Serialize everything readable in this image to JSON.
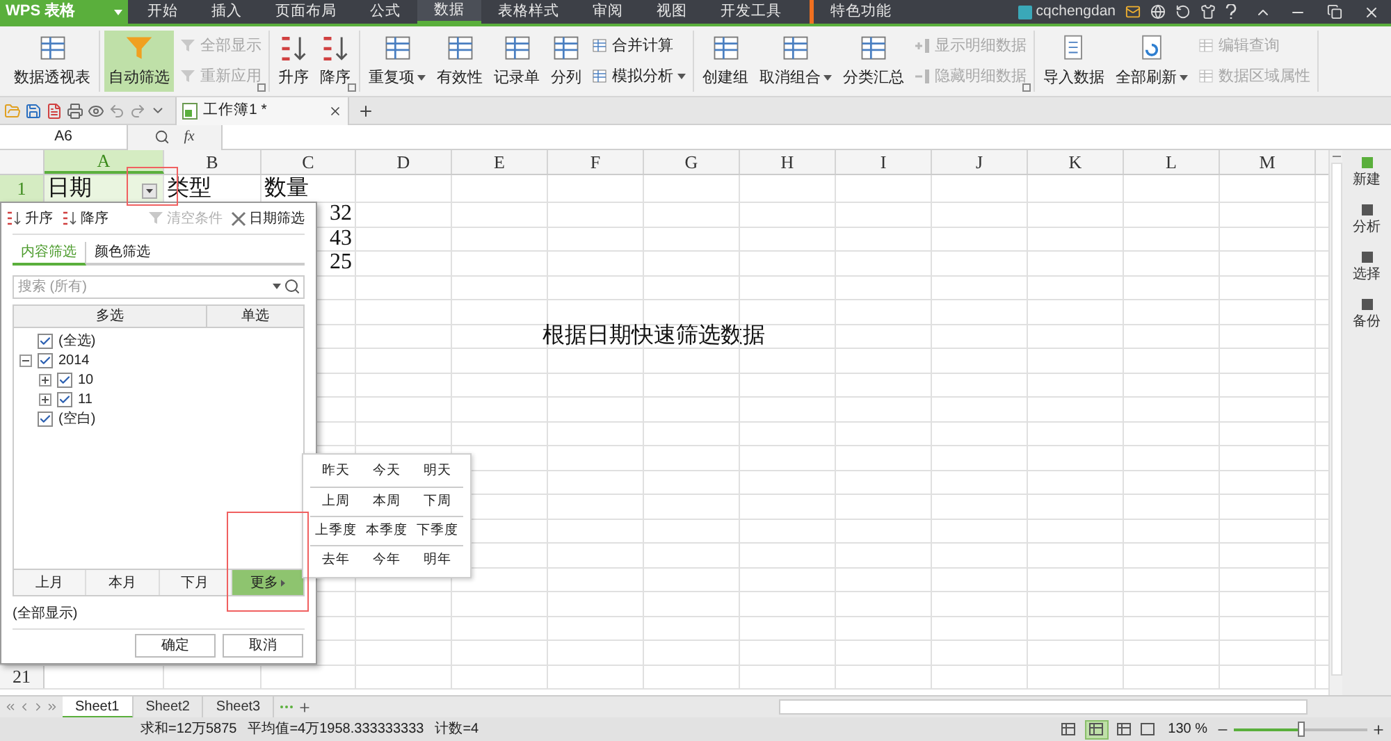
{
  "app_menu": {
    "label": "WPS 表格"
  },
  "menu_tabs": [
    {
      "label": "开始",
      "selected": false
    },
    {
      "label": "插入",
      "selected": false
    },
    {
      "label": "页面布局",
      "selected": false
    },
    {
      "label": "公式",
      "selected": false
    },
    {
      "label": "数据",
      "selected": true
    },
    {
      "label": "表格样式",
      "selected": false
    },
    {
      "label": "审阅",
      "selected": false
    },
    {
      "label": "视图",
      "selected": false
    },
    {
      "label": "开发工具",
      "selected": false
    },
    {
      "label": "特色功能",
      "selected": false
    }
  ],
  "user": {
    "name": "cqchengdan"
  },
  "ribbon": [
    {
      "launcher": false,
      "items": [
        {
          "label": "数据透视表",
          "kind": "large",
          "disabled": false,
          "on": false,
          "dropdown": false
        }
      ]
    },
    {
      "launcher": true,
      "items": [
        {
          "label": "自动筛选",
          "kind": "large",
          "disabled": false,
          "on": true,
          "dropdown": false
        },
        {
          "label": "全部显示",
          "kind": "small",
          "disabled": true,
          "on": false,
          "dropdown": false
        },
        {
          "label": "重新应用",
          "kind": "small",
          "disabled": true,
          "on": false,
          "dropdown": false
        }
      ]
    },
    {
      "launcher": true,
      "items": [
        {
          "label": "升序",
          "kind": "large",
          "disabled": false,
          "on": false,
          "dropdown": false
        },
        {
          "label": "降序",
          "kind": "large",
          "disabled": false,
          "on": false,
          "dropdown": false
        }
      ]
    },
    {
      "launcher": false,
      "items": [
        {
          "label": "重复项",
          "kind": "large",
          "disabled": false,
          "on": false,
          "dropdown": true
        },
        {
          "label": "有效性",
          "kind": "large",
          "disabled": false,
          "on": false,
          "dropdown": false
        },
        {
          "label": "记录单",
          "kind": "large",
          "disabled": false,
          "on": false,
          "dropdown": false
        },
        {
          "label": "分列",
          "kind": "large",
          "disabled": false,
          "on": false,
          "dropdown": false
        },
        {
          "label": "合并计算",
          "kind": "small",
          "disabled": false,
          "on": false,
          "dropdown": false
        },
        {
          "label": "模拟分析",
          "kind": "small",
          "disabled": false,
          "on": false,
          "dropdown": true
        }
      ]
    },
    {
      "launcher": true,
      "items": [
        {
          "label": "创建组",
          "kind": "large",
          "disabled": false,
          "on": false,
          "dropdown": false
        },
        {
          "label": "取消组合",
          "kind": "large",
          "disabled": false,
          "on": false,
          "dropdown": true
        },
        {
          "label": "分类汇总",
          "kind": "large",
          "disabled": false,
          "on": false,
          "dropdown": false
        },
        {
          "label": "显示明细数据",
          "kind": "small",
          "disabled": true,
          "on": false,
          "dropdown": false
        },
        {
          "label": "隐藏明细数据",
          "kind": "small",
          "disabled": true,
          "on": false,
          "dropdown": false
        }
      ]
    },
    {
      "launcher": false,
      "items": [
        {
          "label": "导入数据",
          "kind": "large",
          "disabled": false,
          "on": false,
          "dropdown": false
        },
        {
          "label": "全部刷新",
          "kind": "large",
          "disabled": false,
          "on": false,
          "dropdown": true
        },
        {
          "label": "编辑查询",
          "kind": "small",
          "disabled": true,
          "on": false,
          "dropdown": false
        },
        {
          "label": "数据区域属性",
          "kind": "small",
          "disabled": true,
          "on": false,
          "dropdown": false
        }
      ]
    }
  ],
  "document_tab": {
    "title": "工作簿1 *"
  },
  "name_box": {
    "value": "A6"
  },
  "formula_label": "fx",
  "columns": [
    {
      "label": "A",
      "selected": true
    },
    {
      "label": "B",
      "selected": false
    },
    {
      "label": "C",
      "selected": false
    },
    {
      "label": "D",
      "selected": false
    },
    {
      "label": "E",
      "selected": false
    },
    {
      "label": "F",
      "selected": false
    },
    {
      "label": "G",
      "selected": false
    },
    {
      "label": "H",
      "selected": false
    },
    {
      "label": "I",
      "selected": false
    },
    {
      "label": "J",
      "selected": false
    },
    {
      "label": "K",
      "selected": false
    },
    {
      "label": "L",
      "selected": false
    },
    {
      "label": "M",
      "selected": false
    }
  ],
  "rows": [
    {
      "number": "1",
      "selected": true,
      "filter_button": true,
      "cells": {
        "A": "日期",
        "B": "类型",
        "C": "数量"
      }
    },
    {
      "cells": {
        "C": "32"
      }
    },
    {
      "cells": {
        "C": "43"
      }
    },
    {
      "cells": {
        "C": "25"
      }
    },
    {},
    {},
    {
      "cells": {
        "F": "根据日期快速筛选数据"
      }
    },
    {},
    {},
    {},
    {},
    {},
    {},
    {},
    {},
    {},
    {},
    {},
    {},
    {},
    {
      "number": "21",
      "selected": false
    }
  ],
  "filter_panel": {
    "sort_buttons": [
      "升序",
      "降序"
    ],
    "clear": {
      "label": "清空条件",
      "disabled": true
    },
    "date_filter": "日期筛选",
    "tabs": [
      {
        "label": "内容筛选",
        "selected": true
      },
      {
        "label": "颜色筛选",
        "selected": false
      }
    ],
    "search": {
      "placeholder": "搜索 (所有)"
    },
    "list_headers": [
      "多选",
      "单选"
    ],
    "tree": [
      {
        "label": "(全选)",
        "checked": true
      },
      {
        "label": "2014",
        "checked": true,
        "expanded": true,
        "children": [
          {
            "label": "10",
            "checked": true,
            "expanded": false
          },
          {
            "label": "11",
            "checked": true,
            "expanded": false
          }
        ]
      },
      {
        "label": "(空白)",
        "checked": true
      }
    ],
    "quick_buttons": [
      {
        "label": "上月",
        "selected": false
      },
      {
        "label": "本月",
        "selected": false
      },
      {
        "label": "下月",
        "selected": false
      },
      {
        "label": "更多",
        "selected": true
      }
    ],
    "status": "(全部显示)",
    "buttons": [
      "确定",
      "取消"
    ]
  },
  "more_menu": [
    [
      "昨天",
      "今天",
      "明天"
    ],
    [
      "上周",
      "本周",
      "下周"
    ],
    [
      "上季度",
      "本季度",
      "下季度"
    ],
    [
      "去年",
      "今年",
      "明年"
    ]
  ],
  "side_panel": [
    "新建",
    "分析",
    "选择",
    "备份"
  ],
  "sheet_tabs": [
    {
      "label": "Sheet1",
      "selected": true
    },
    {
      "label": "Sheet2",
      "selected": false
    },
    {
      "label": "Sheet3",
      "selected": false
    }
  ],
  "status_bar": {
    "sum": "求和=12万5875",
    "average": "平均值=4万1958.333333333",
    "count": "计数=4",
    "views": [
      {
        "selected": false
      },
      {
        "selected": true
      },
      {
        "selected": false
      }
    ],
    "zoom": "130 %",
    "zoom_slider": {
      "level": 0.5
    }
  }
}
